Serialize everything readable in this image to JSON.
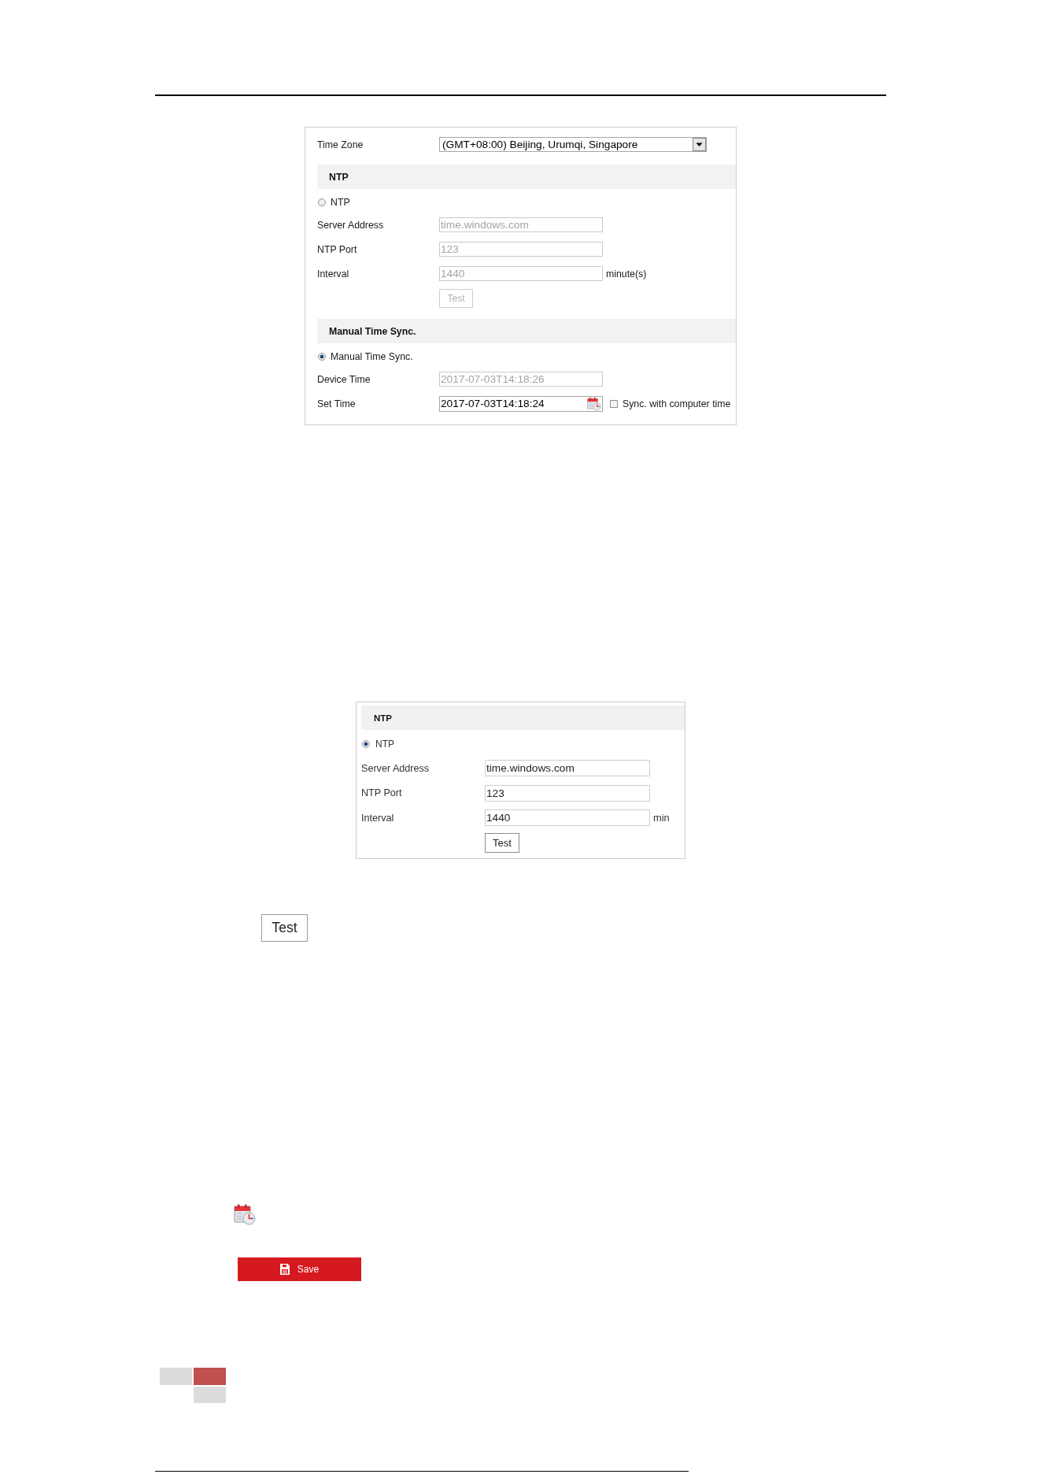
{
  "panels": [
    {
      "rows": [
        {
          "kind": "select",
          "label": "Time Zone",
          "value": "(GMT+08:00) Beijing, Urumqi, Singapore"
        },
        {
          "kind": "section",
          "title": "NTP"
        },
        {
          "kind": "radio",
          "label": "NTP",
          "selected": false
        },
        {
          "kind": "input",
          "label": "Server Address",
          "value": "time.windows.com",
          "disabled": true
        },
        {
          "kind": "input",
          "label": "NTP Port",
          "value": "123",
          "disabled": true
        },
        {
          "kind": "input",
          "label": "Interval",
          "value": "1440",
          "unit": "minute(s)",
          "disabled": true
        },
        {
          "kind": "button",
          "label": "Test",
          "disabled": true
        },
        {
          "kind": "section",
          "title": "Manual Time Sync."
        },
        {
          "kind": "radio",
          "label": "Manual Time Sync.",
          "selected": true
        },
        {
          "kind": "input",
          "label": "Device Time",
          "value": "2017-07-03T14:18:26",
          "disabled": true
        },
        {
          "kind": "datetime",
          "label": "Set Time",
          "value": "2017-07-03T14:18:24",
          "checkbox_label": "Sync. with computer time",
          "checked": false
        }
      ]
    },
    {
      "rows": [
        {
          "kind": "section",
          "title": "NTP"
        },
        {
          "kind": "radio",
          "label": "NTP",
          "selected": true
        },
        {
          "kind": "input",
          "label": "Server Address",
          "value": "time.windows.com",
          "disabled": false
        },
        {
          "kind": "input",
          "label": "NTP Port",
          "value": "123",
          "disabled": false
        },
        {
          "kind": "input",
          "label": "Interval",
          "value": "1440",
          "unit": "min",
          "disabled": false
        },
        {
          "kind": "button",
          "label": "Test",
          "disabled": false
        }
      ]
    }
  ],
  "test_button": {
    "label": "Test"
  },
  "save_button": {
    "label": "Save"
  }
}
